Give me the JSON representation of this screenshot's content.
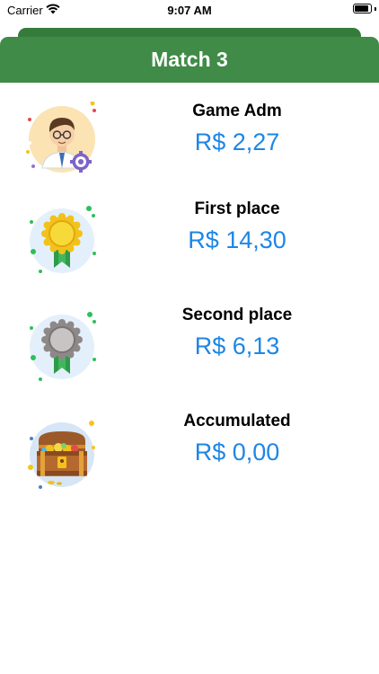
{
  "status_bar": {
    "carrier": "Carrier",
    "time": "9:07 AM",
    "battery_level": 0.9,
    "icons": [
      "wifi-icon",
      "battery-icon"
    ]
  },
  "header": {
    "title": "Match 3"
  },
  "prizes": [
    {
      "label": "Game Adm",
      "amount": "R$ 2,27",
      "icon": "game-admin-icon"
    },
    {
      "label": "First place",
      "amount": "R$ 14,30",
      "icon": "gold-medal-icon"
    },
    {
      "label": "Second place",
      "amount": "R$ 6,13",
      "icon": "silver-medal-icon"
    },
    {
      "label": "Accumulated",
      "amount": "R$ 0,00",
      "icon": "treasure-chest-icon"
    }
  ],
  "colors": {
    "header_green": "#3f8b47",
    "header_back": "#357c3c",
    "amount_blue": "#1e86e6",
    "gold": "#f5cf1a",
    "silver": "#b8b3b3",
    "ribbon_green": "#2f9a4a"
  }
}
